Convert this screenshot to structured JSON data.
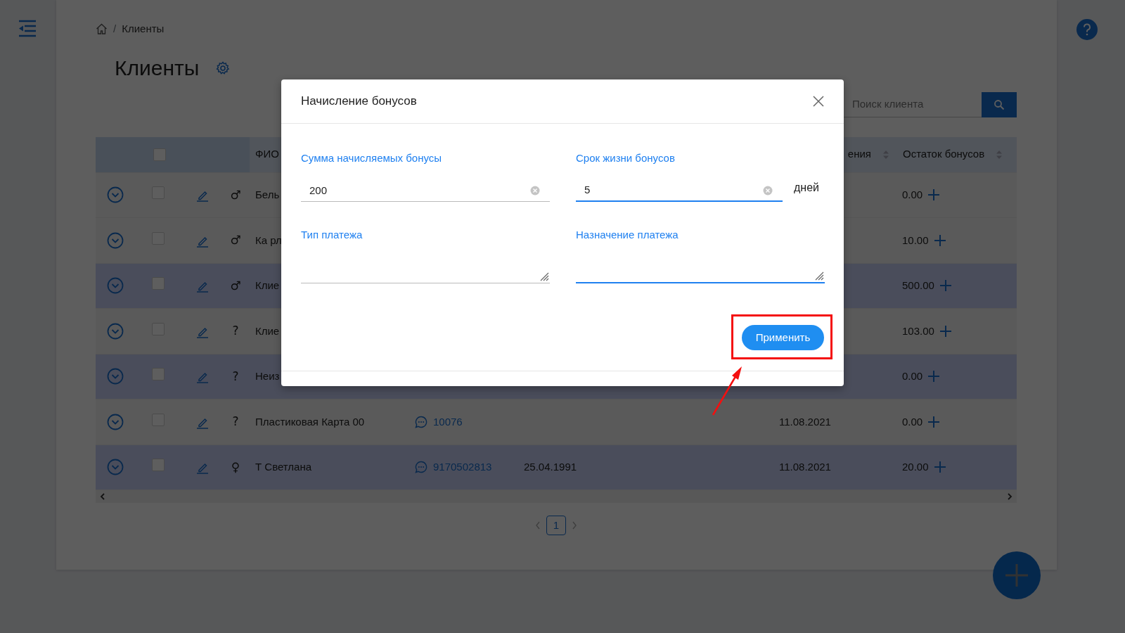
{
  "breadcrumb": {
    "separator": "/",
    "current": "Клиенты"
  },
  "page_title": "Клиенты",
  "search": {
    "placeholder": "Поиск клиента"
  },
  "table": {
    "header_checked": false,
    "columns": [
      {
        "label": "ФИО",
        "sortable": false
      },
      {
        "label": "ения",
        "sortable": true
      },
      {
        "label": "Остаток бонусов",
        "sortable": true
      }
    ],
    "rows": [
      {
        "selected": false,
        "checked": false,
        "gender": "♂",
        "name": "Бель",
        "balance": "0.00"
      },
      {
        "selected": false,
        "checked": false,
        "gender": "♂",
        "name": "Ка рл",
        "balance": "10.00"
      },
      {
        "selected": true,
        "checked": false,
        "gender": "♂",
        "name": "Клие",
        "balance": "500.00"
      },
      {
        "selected": false,
        "checked": false,
        "gender": "?",
        "name": "Клие",
        "balance": "103.00"
      },
      {
        "selected": true,
        "checked": false,
        "gender": "?",
        "name": "Неиз",
        "balance": "0.00"
      },
      {
        "selected": false,
        "checked": false,
        "gender": "?",
        "name": "Пластиковая Карта 00",
        "phone": "10076",
        "registered": "11.08.2021",
        "balance": "0.00"
      },
      {
        "selected": true,
        "checked": false,
        "gender": "♀",
        "name": "Т Светлана",
        "phone": "9170502813",
        "birth_date": "25.04.1991",
        "registered": "11.08.2021",
        "balance": "20.00"
      }
    ]
  },
  "pagination": [
    {
      "label": "1",
      "selected": true
    }
  ],
  "modal": {
    "title": "Начисление бонусов",
    "fields": [
      {
        "kind": "input",
        "label": "Сумма начисляемых бонусы",
        "value": "200",
        "active": false
      },
      {
        "kind": "input",
        "label": "Срок жизни бонусов",
        "value": "5",
        "suffix": "дней",
        "active": true
      },
      {
        "kind": "textarea",
        "label": "Тип платежа",
        "active": false
      },
      {
        "kind": "textarea",
        "label": "Назначение платежа",
        "active": true
      }
    ],
    "submit": "Применить"
  }
}
